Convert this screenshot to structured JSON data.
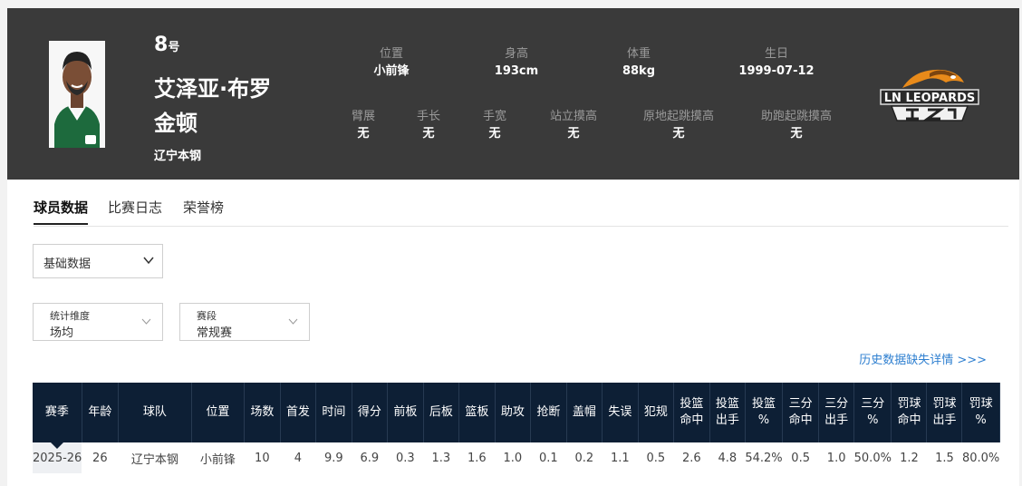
{
  "player": {
    "number": "8",
    "number_suffix": "号",
    "name": "艾泽亚·布罗金顿",
    "team": "辽宁本钢"
  },
  "info_top": [
    {
      "label": "位置",
      "value": "小前锋"
    },
    {
      "label": "身高",
      "value": "193cm"
    },
    {
      "label": "体重",
      "value": "88kg"
    },
    {
      "label": "生日",
      "value": "1999-07-12"
    }
  ],
  "info_bottom": [
    {
      "label": "臂展",
      "value": "无"
    },
    {
      "label": "手长",
      "value": "无"
    },
    {
      "label": "手宽",
      "value": "无"
    },
    {
      "label": "站立摸高",
      "value": "无"
    },
    {
      "label": "原地起跳摸高",
      "value": "无"
    },
    {
      "label": "助跑起跳摸高",
      "value": "无"
    }
  ],
  "logo": {
    "text": "LN LEOPARDS"
  },
  "tabs": [
    "球员数据",
    "比赛日志",
    "荣誉榜"
  ],
  "stat_type_select": {
    "value": "基础数据"
  },
  "filters": [
    {
      "label": "统计维度",
      "value": "场均"
    },
    {
      "label": "赛段",
      "value": "常规赛"
    }
  ],
  "history_link": "历史数据缺失详情 >>>",
  "table": {
    "headers": [
      [
        "赛季"
      ],
      [
        "年龄"
      ],
      [
        "球队"
      ],
      [
        "位置"
      ],
      [
        "场数"
      ],
      [
        "首发"
      ],
      [
        "时间"
      ],
      [
        "得分"
      ],
      [
        "前板"
      ],
      [
        "后板"
      ],
      [
        "篮板"
      ],
      [
        "助攻"
      ],
      [
        "抢断"
      ],
      [
        "盖帽"
      ],
      [
        "失误"
      ],
      [
        "犯规"
      ],
      [
        "投篮",
        "命中"
      ],
      [
        "投篮",
        "出手"
      ],
      [
        "投篮",
        "%"
      ],
      [
        "三分",
        "命中"
      ],
      [
        "三分",
        "出手"
      ],
      [
        "三分",
        "%"
      ],
      [
        "罚球",
        "命中"
      ],
      [
        "罚球",
        "出手"
      ],
      [
        "罚球",
        "%"
      ]
    ],
    "rows": [
      [
        "2025-26",
        "26",
        "辽宁本钢",
        "小前锋",
        "10",
        "4",
        "9.9",
        "6.9",
        "0.3",
        "1.3",
        "1.6",
        "1.0",
        "0.1",
        "0.2",
        "1.1",
        "0.5",
        "2.6",
        "4.8",
        "54.2%",
        "0.5",
        "1.0",
        "50.0%",
        "1.2",
        "1.5",
        "80.0%"
      ]
    ]
  },
  "colors": {
    "header_bg": "#3a3a3a",
    "table_header_bg": "#0d1f35",
    "link": "#2e7fd0",
    "logo_orange": "#e88a1a"
  }
}
